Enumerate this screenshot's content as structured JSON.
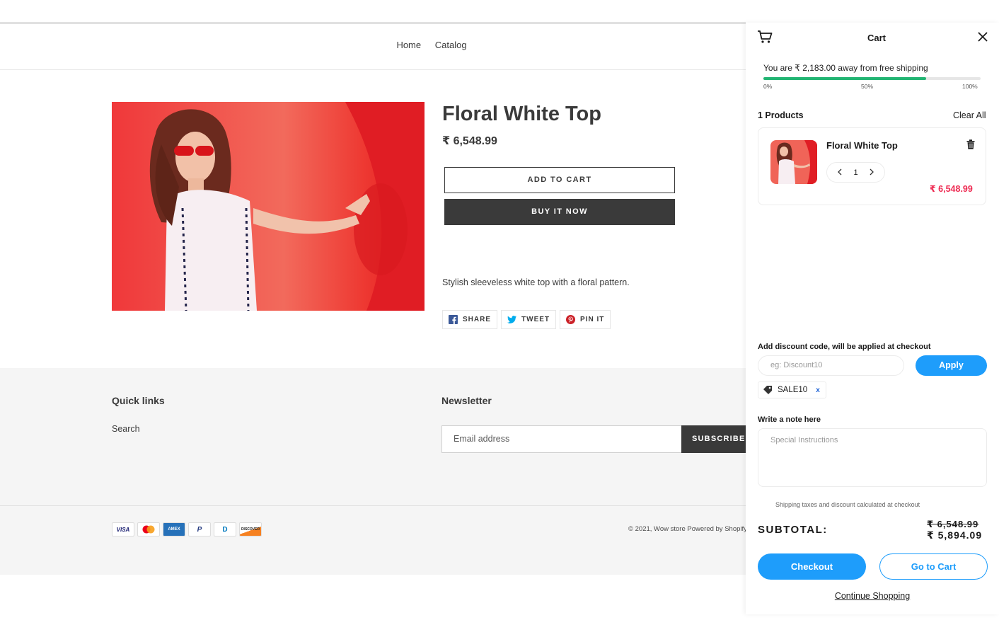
{
  "nav": {
    "items": [
      "Home",
      "Catalog"
    ]
  },
  "product": {
    "title": "Floral White Top",
    "price": "₹ 6,548.99",
    "add_to_cart": "ADD TO CART",
    "buy_now": "BUY IT NOW",
    "description": "Stylish sleeveless white top with a floral pattern.",
    "share": {
      "facebook": "SHARE",
      "twitter": "TWEET",
      "pinterest": "PIN IT"
    }
  },
  "footer": {
    "quick_links_title": "Quick links",
    "quick_links": [
      "Search"
    ],
    "newsletter_title": "Newsletter",
    "email_placeholder": "Email address",
    "subscribe": "SUBSCRIBE",
    "payment_icons": [
      "VISA",
      "mastercard",
      "AMEX",
      "P",
      "D",
      "DISCOVER"
    ],
    "copyright": "© 2021, Wow store Powered by Shopify"
  },
  "cart": {
    "title": "Cart",
    "shipping_message": "You are ₹ 2,183.00 away from free shipping",
    "progress_fraction": 0.75,
    "progress_labels": [
      "0%",
      "50%",
      "100%"
    ],
    "products_count": "1 Products",
    "clear_all": "Clear All",
    "item": {
      "name": "Floral White Top",
      "quantity": "1",
      "price": "₹ 6,548.99"
    },
    "discount_label": "Add discount code, will be applied at checkout",
    "discount_placeholder": "eg: Discount10",
    "apply": "Apply",
    "coupon_code": "SALE10",
    "coupon_remove": "x",
    "note_label": "Write a note here",
    "note_placeholder": "Special Instructions",
    "calc_note": "Shipping taxes and discount calculated at checkout",
    "subtotal_label": "SUBTOTAL:",
    "original_total": "₹ 6,548.99",
    "discounted_total": "₹ 5,894.09",
    "checkout": "Checkout",
    "go_to_cart": "Go to Cart",
    "continue_shopping": "Continue Shopping"
  },
  "colors": {
    "accent_blue": "#1e9dfb",
    "progress_green": "#22b573",
    "price_red": "#ee2b52",
    "dark_button": "#3a3a3a"
  }
}
